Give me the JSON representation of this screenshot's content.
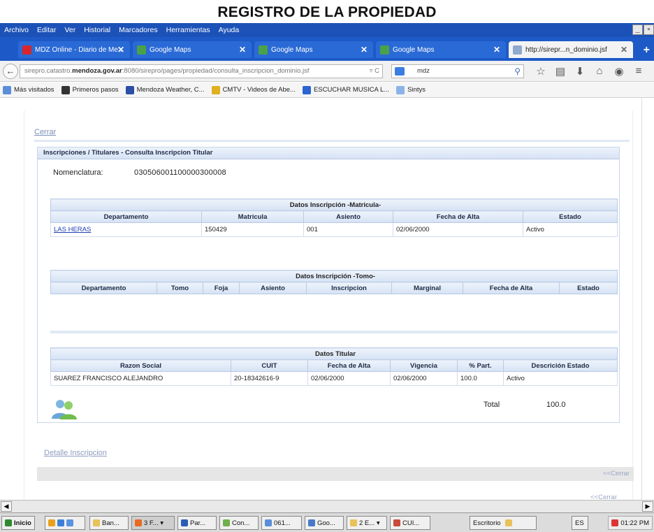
{
  "heading": "REGISTRO DE LA PROPIEDAD",
  "menu": [
    "Archivo",
    "Editar",
    "Ver",
    "Historial",
    "Marcadores",
    "Herramientas",
    "Ayuda"
  ],
  "tabs": [
    {
      "label": "MDZ Online - Diario de Me...",
      "color": "#d8262c"
    },
    {
      "label": "Google Maps",
      "color": "#4aa14a"
    },
    {
      "label": "Google Maps",
      "color": "#4aa14a"
    },
    {
      "label": "Google Maps",
      "color": "#4aa14a"
    },
    {
      "label": "http://sirepr...n_dominio.jsf",
      "color": "#8fa9cf"
    }
  ],
  "nav": {
    "url_prefix": "sirepro.catastro.",
    "url_bold": "mendoza.gov.ar",
    "url_suffix": ":8080/sirepro/pages/propiedad/consulta_inscripcion_dominio.jsf",
    "search_value": "mdz"
  },
  "bookmarks": [
    "Más visitados",
    "Primeros pasos",
    "Mendoza Weather, C...",
    "CMTV - Videos de Abe...",
    "ESCUCHAR MUSICA L...",
    "Sintys"
  ],
  "page": {
    "cerrar": "Cerrar",
    "box_title": "Inscripciones / Titulares - Consulta Inscripcion Titular",
    "nomenclatura_label": "Nomenclatura:",
    "nomenclatura_value": "03050600110000030000​8",
    "matricula": {
      "caption": "Datos Inscripción -Matricula-",
      "headers": [
        "Departamento",
        "Matricula",
        "Asiento",
        "Fecha de Alta",
        "Estado"
      ],
      "row": [
        "LAS HERAS",
        "150429",
        "001",
        "02/06/2000",
        "Activo"
      ]
    },
    "tomo": {
      "caption": "Datos Inscripción -Tomo-",
      "headers": [
        "Departamento",
        "Tomo",
        "Foja",
        "Asiento",
        "Inscripcion",
        "Marginal",
        "Fecha de Alta",
        "Estado"
      ]
    },
    "titular": {
      "caption": "Datos Titular",
      "headers": [
        "Razon Social",
        "CUIT",
        "Fecha de Alta",
        "Vigencia",
        "% Part.",
        "Descrición Estado"
      ],
      "row": [
        "SUAREZ FRANCISCO ALEJANDRO",
        "20-18342616-9",
        "02/06/2000",
        "02/06/2000",
        "100.0",
        "Activo"
      ]
    },
    "total_label": "Total",
    "total_value": "100.0",
    "detalle": "Detalle Inscripcion",
    "cerrar_small": "<<Cerrar",
    "cerrar_small2": "<<Cerrar"
  },
  "taskbar": {
    "start": "Inicio",
    "items": [
      "Ban...",
      "3 F... ▾",
      "Par...",
      "Con...",
      "061...",
      "Goo...",
      "2 E... ▾",
      "CUI..."
    ],
    "escritorio": "Escritorio",
    "lang": "ES",
    "clock": "01:22 PM"
  }
}
